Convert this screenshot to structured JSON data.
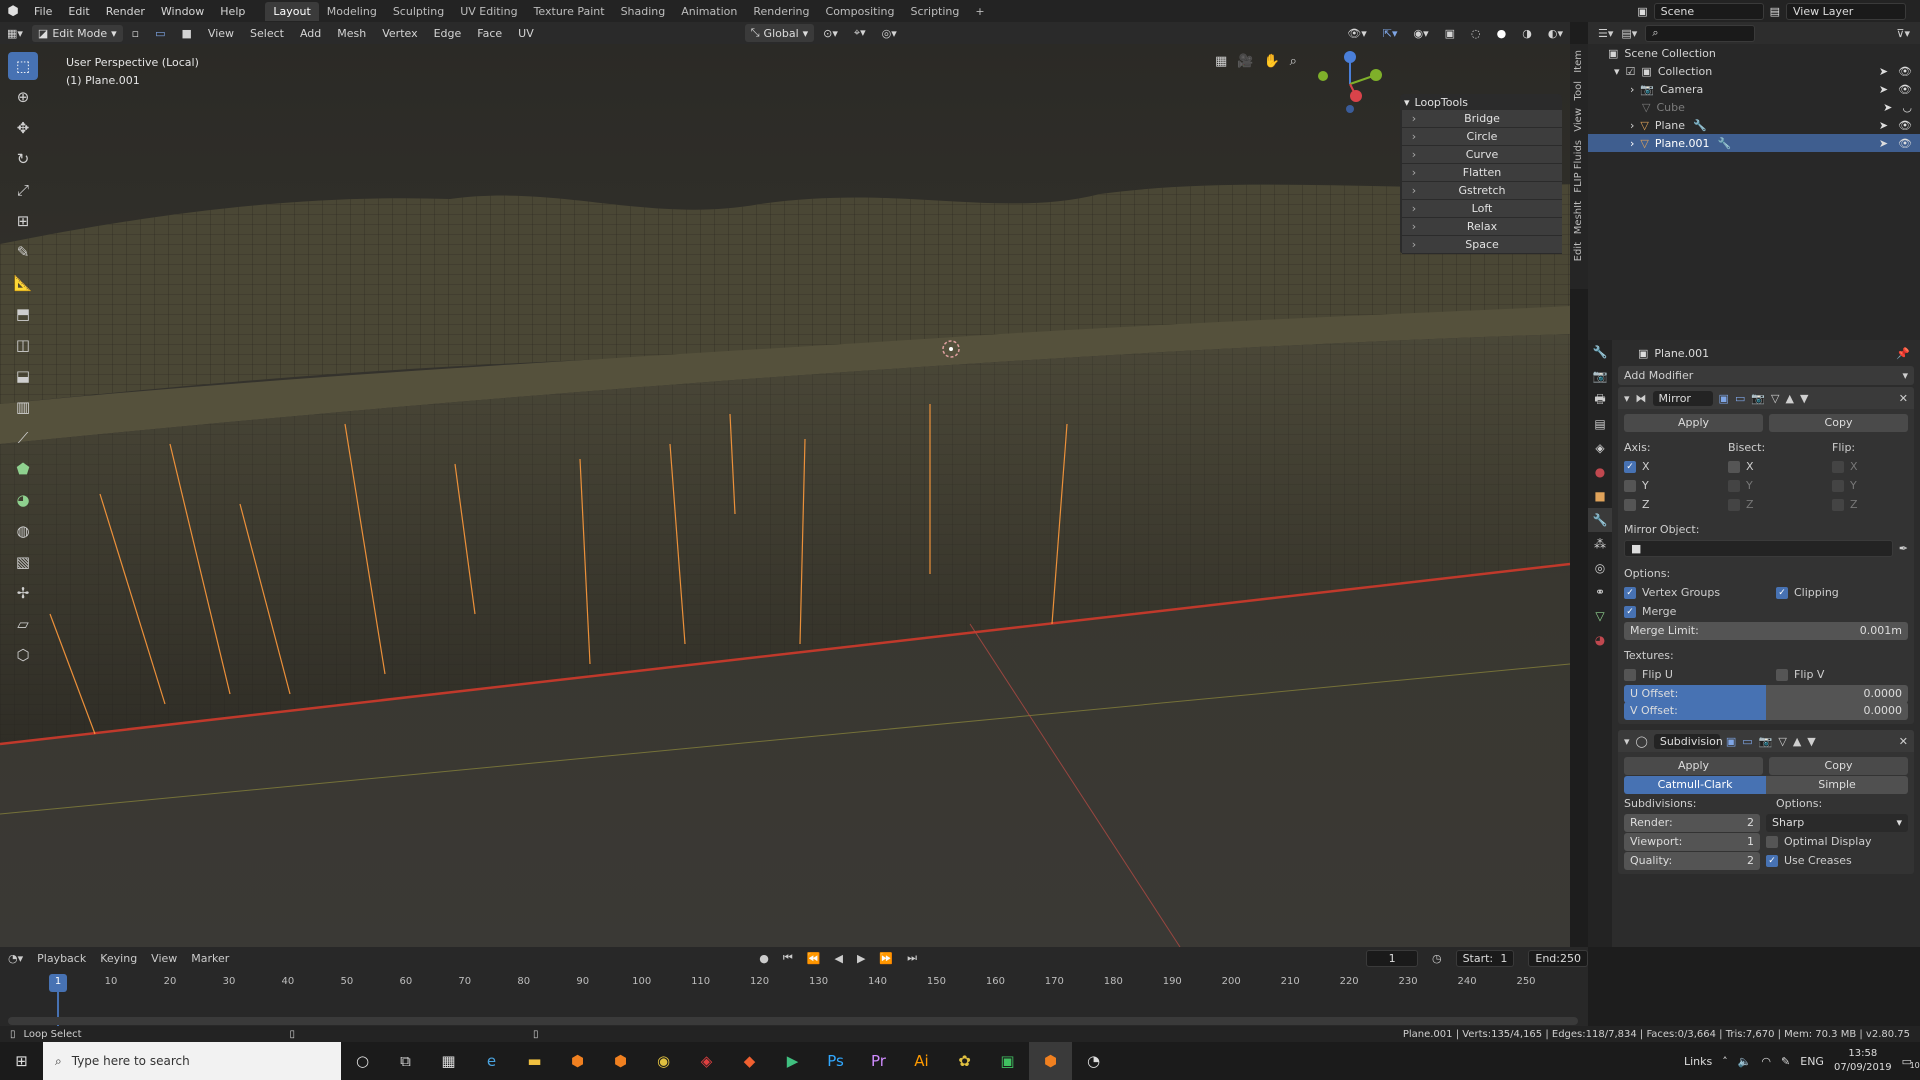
{
  "app": {
    "menus": [
      "File",
      "Edit",
      "Render",
      "Window",
      "Help"
    ],
    "workspaces": [
      "Layout",
      "Modeling",
      "Sculpting",
      "UV Editing",
      "Texture Paint",
      "Shading",
      "Animation",
      "Rendering",
      "Compositing",
      "Scripting",
      "+"
    ],
    "active_workspace": "Layout",
    "scene": "Scene",
    "view_layer": "View Layer"
  },
  "viewport_header": {
    "mode": "Edit Mode",
    "menus": [
      "View",
      "Select",
      "Add",
      "Mesh",
      "Vertex",
      "Edge",
      "Face",
      "UV"
    ],
    "orientation": "Global"
  },
  "viewport": {
    "perspective": "User Perspective (Local)",
    "object": "(1) Plane.001",
    "side_tabs": [
      "Item",
      "Tool",
      "View",
      "FLIP Fluids",
      "MeshIt",
      "Edit"
    ]
  },
  "looptools": {
    "title": "LoopTools",
    "buttons": [
      "Bridge",
      "Circle",
      "Curve",
      "Flatten",
      "Gstretch",
      "Loft",
      "Relax",
      "Space"
    ]
  },
  "outliner": {
    "root": "Scene Collection",
    "rows": [
      {
        "label": "Collection",
        "level": 1,
        "state": "normal"
      },
      {
        "label": "Camera",
        "level": 2,
        "state": "normal"
      },
      {
        "label": "Cube",
        "level": 2,
        "state": "dim"
      },
      {
        "label": "Plane",
        "level": 2,
        "state": "normal"
      },
      {
        "label": "Plane.001",
        "level": 2,
        "state": "selected"
      }
    ]
  },
  "properties": {
    "object_name": "Plane.001",
    "add_modifier": "Add Modifier",
    "mirror": {
      "name": "Mirror",
      "apply": "Apply",
      "copy": "Copy",
      "axis_label": "Axis:",
      "bisect_label": "Bisect:",
      "flip_label": "Flip:",
      "axes": [
        "X",
        "Y",
        "Z"
      ],
      "axis_on": [
        true,
        false,
        false
      ],
      "mirror_object_label": "Mirror Object:",
      "options_label": "Options:",
      "vertex_groups": "Vertex Groups",
      "clipping": "Clipping",
      "merge": "Merge",
      "merge_limit_label": "Merge Limit:",
      "merge_limit": "0.001m",
      "textures_label": "Textures:",
      "flip_u": "Flip U",
      "flip_v": "Flip V",
      "u_offset_label": "U Offset:",
      "u_offset": "0.0000",
      "v_offset_label": "V Offset:",
      "v_offset": "0.0000"
    },
    "subdivision": {
      "name": "Subdivision",
      "apply": "Apply",
      "copy": "Copy",
      "catmull": "Catmull-Clark",
      "simple": "Simple",
      "subdivisions_label": "Subdivisions:",
      "options_label": "Options:",
      "render_label": "Render:",
      "render": "2",
      "viewport_label": "Viewport:",
      "viewport": "1",
      "quality_label": "Quality:",
      "quality": "2",
      "sharp": "Sharp",
      "optimal_display": "Optimal Display",
      "use_creases": "Use Creases"
    }
  },
  "timeline": {
    "menus": [
      "Playback",
      "Keying",
      "View",
      "Marker"
    ],
    "current_frame": "1",
    "start_label": "Start:",
    "start": "1",
    "end_label": "End:",
    "end": "250",
    "ticks": [
      "1",
      "10",
      "20",
      "30",
      "40",
      "50",
      "60",
      "70",
      "80",
      "90",
      "100",
      "110",
      "120",
      "130",
      "140",
      "150",
      "160",
      "170",
      "180",
      "190",
      "200",
      "210",
      "220",
      "230",
      "240",
      "250"
    ]
  },
  "status": {
    "left": "Loop Select",
    "right": "Plane.001 | Verts:135/4,165 | Edges:118/7,834 | Faces:0/3,664 | Tris:7,670 | Mem: 70.3 MB | v2.80.75"
  },
  "taskbar": {
    "search_placeholder": "Type here to search",
    "links": "Links",
    "lang": "ENG",
    "time": "13:58",
    "date": "07/09/2019",
    "notification_count": "10"
  },
  "colors": {
    "accent": "#4772b3",
    "selection": "#3f5e8f",
    "edge_select": "#ff9a3c"
  }
}
